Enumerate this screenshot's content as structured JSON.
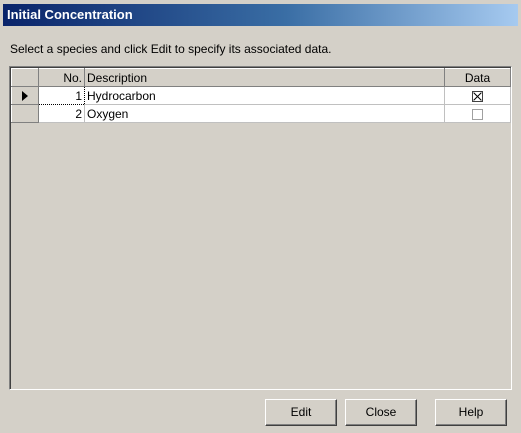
{
  "window": {
    "title": "Initial Concentration"
  },
  "instruction": "Select a species and click Edit to specify its associated data.",
  "grid": {
    "columns": {
      "no": "No.",
      "description": "Description",
      "data": "Data"
    },
    "rows": [
      {
        "no": "1",
        "description": "Hydrocarbon",
        "data_checked": true,
        "current": true
      },
      {
        "no": "2",
        "description": "Oxygen",
        "data_checked": false,
        "current": false
      }
    ]
  },
  "buttons": {
    "edit": "Edit",
    "close": "Close",
    "help": "Help"
  }
}
